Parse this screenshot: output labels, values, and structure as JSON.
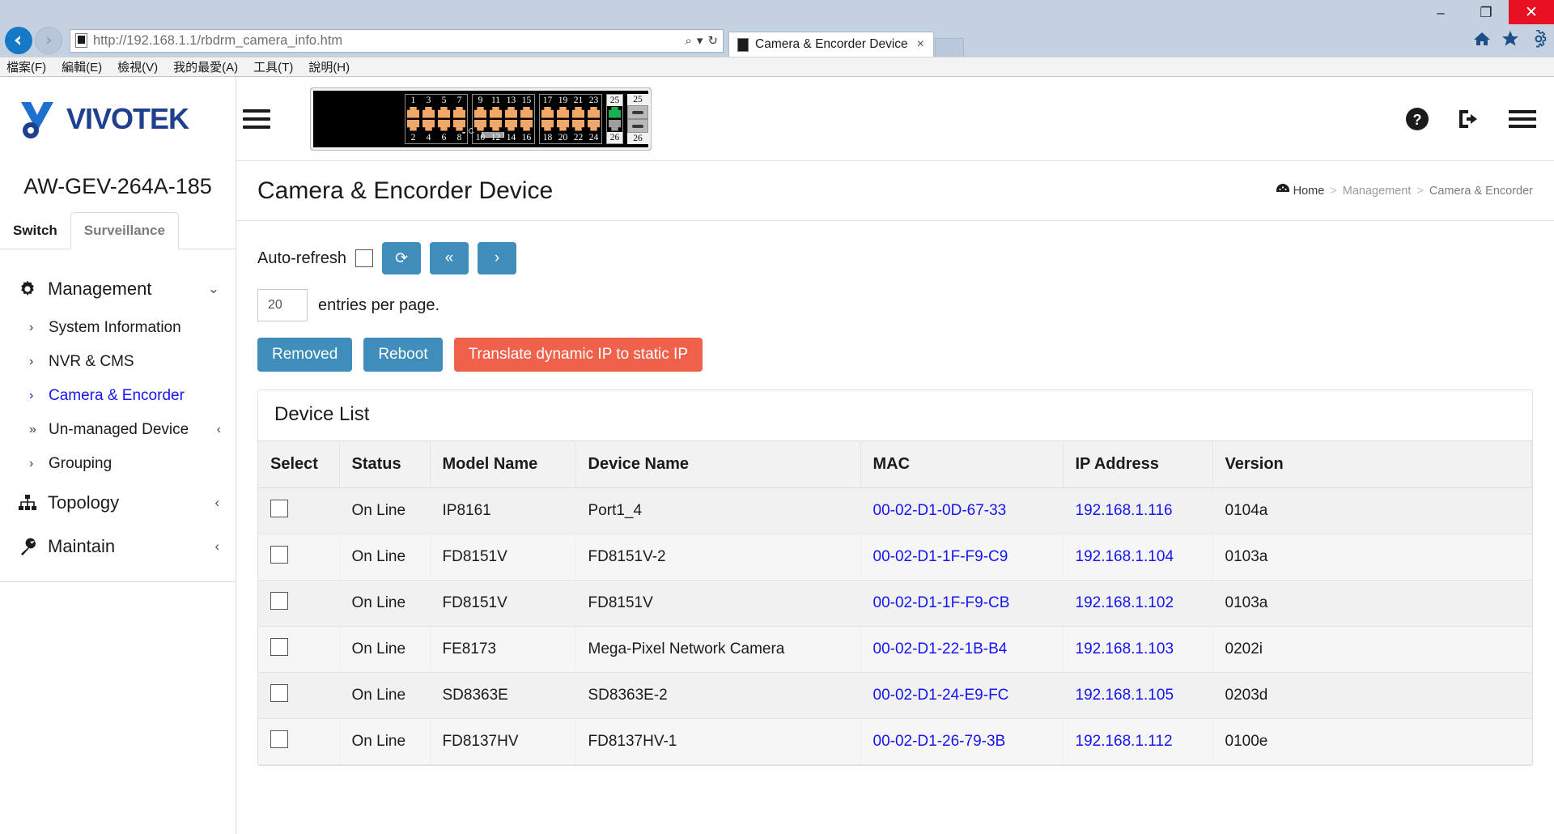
{
  "browser": {
    "url": "http://192.168.1.1/rbdrm_camera_info.htm",
    "tab_title": "Camera & Encorder Device",
    "tab_close": "×",
    "search_icon": "⌕",
    "refresh_icon": "↻",
    "dropdown_caret": "▾",
    "window_minimize": "–",
    "window_restore": "❐",
    "window_close": "✕",
    "menus": [
      "檔案(F)",
      "編輯(E)",
      "檢視(V)",
      "我的最愛(A)",
      "工具(T)",
      "說明(H)"
    ],
    "toolbar_icons": [
      "home-icon",
      "favorites-icon",
      "settings-icon"
    ]
  },
  "brand": {
    "name": "VIVOTEK",
    "device_name": "AW-GEV-264A-185"
  },
  "sidebar": {
    "tabs": [
      {
        "label": "Switch",
        "active": true
      },
      {
        "label": "Surveillance",
        "active": false
      }
    ],
    "groups": [
      {
        "label": "Management",
        "icon": "gear-icon",
        "caret": "⌄",
        "items": [
          {
            "label": "System Information",
            "chev": "›",
            "active": false,
            "tail": ""
          },
          {
            "label": "NVR & CMS",
            "chev": "›",
            "active": false,
            "tail": ""
          },
          {
            "label": "Camera & Encorder",
            "chev": "›",
            "active": true,
            "tail": ""
          },
          {
            "label": "Un-managed Device",
            "chev": "»",
            "active": false,
            "tail": "‹"
          },
          {
            "label": "Grouping",
            "chev": "›",
            "active": false,
            "tail": ""
          }
        ]
      },
      {
        "label": "Topology",
        "icon": "sitemap-icon",
        "caret": "‹",
        "items": []
      },
      {
        "label": "Maintain",
        "icon": "wrench-icon",
        "caret": "‹",
        "items": []
      }
    ]
  },
  "topbar": {
    "hamburger_left": "menu-icon",
    "help_icon": "help-circle-icon",
    "logout_icon": "logout-icon",
    "menu_icon": "hamburger-icon",
    "switch_ports_top": [
      "1",
      "3",
      "5",
      "7",
      "9",
      "11",
      "13",
      "15",
      "17",
      "19",
      "21",
      "23",
      "25"
    ],
    "switch_ports_bottom": [
      "2",
      "4",
      "6",
      "8",
      "10",
      "12",
      "14",
      "16",
      "18",
      "20",
      "22",
      "24",
      "26"
    ],
    "sfp_top": "25",
    "sfp_bottom": "26",
    "active_port": "25"
  },
  "page": {
    "title": "Camera & Encorder Device",
    "breadcrumb": {
      "home": "Home",
      "home_icon": "dashboard-icon",
      "sep": ">",
      "middle": "Management",
      "current": "Camera & Encorder"
    }
  },
  "toolbar": {
    "auto_refresh_label": "Auto-refresh",
    "auto_refresh_checked": false,
    "refresh_icon": "⟳",
    "first_icon": "«",
    "next_icon": "›",
    "entries_value": "20",
    "entries_label": "entries per page.",
    "removed_label": "Removed",
    "reboot_label": "Reboot",
    "translate_label": "Translate dynamic IP to static IP"
  },
  "device_list": {
    "panel_title": "Device List",
    "columns": [
      "Select",
      "Status",
      "Model Name",
      "Device Name",
      "MAC",
      "IP Address",
      "Version"
    ],
    "rows": [
      {
        "status": "On Line",
        "model": "IP8161",
        "device": "Port1_4",
        "mac": "00-02-D1-0D-67-33",
        "ip": "192.168.1.116",
        "version": "0104a"
      },
      {
        "status": "On Line",
        "model": "FD8151V",
        "device": "FD8151V-2",
        "mac": "00-02-D1-1F-F9-C9",
        "ip": "192.168.1.104",
        "version": "0103a"
      },
      {
        "status": "On Line",
        "model": "FD8151V",
        "device": "FD8151V",
        "mac": "00-02-D1-1F-F9-CB",
        "ip": "192.168.1.102",
        "version": "0103a"
      },
      {
        "status": "On Line",
        "model": "FE8173",
        "device": "Mega-Pixel Network Camera",
        "mac": "00-02-D1-22-1B-B4",
        "ip": "192.168.1.103",
        "version": "0202i"
      },
      {
        "status": "On Line",
        "model": "SD8363E",
        "device": "SD8363E-2",
        "mac": "00-02-D1-24-E9-FC",
        "ip": "192.168.1.105",
        "version": "0203d"
      },
      {
        "status": "On Line",
        "model": "FD8137HV",
        "device": "FD8137HV-1",
        "mac": "00-02-D1-26-79-3B",
        "ip": "192.168.1.112",
        "version": "0100e"
      }
    ]
  },
  "colors": {
    "accent_blue": "#3f8dba",
    "accent_red": "#f0614c",
    "link_blue": "#1515f0",
    "brand_blue": "#1f3f8f",
    "port_orange": "#f0a868",
    "port_active_green": "#18b04e"
  }
}
